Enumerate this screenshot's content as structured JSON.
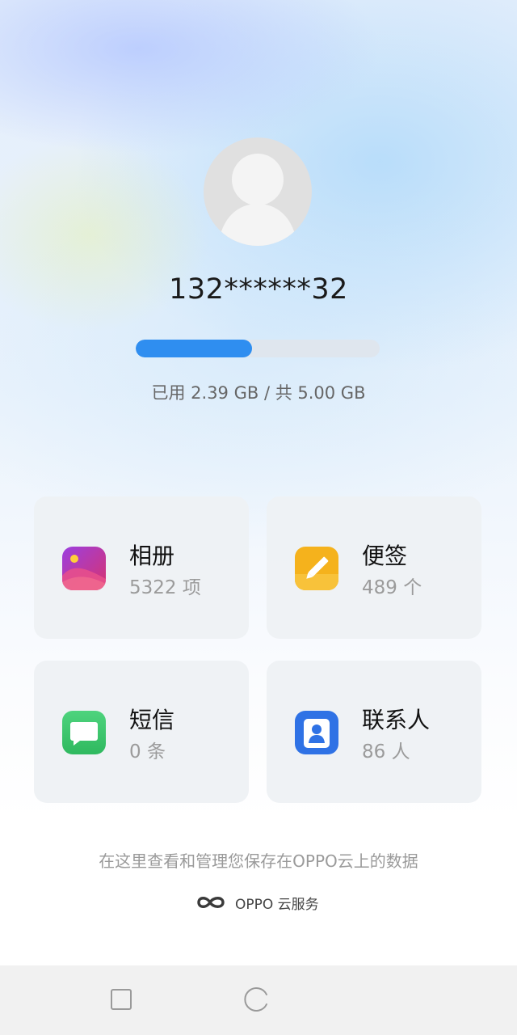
{
  "profile": {
    "account": "132******32"
  },
  "storage": {
    "used_fraction": 0.478,
    "text": "已用 2.39 GB / 共 5.00 GB",
    "bar_color": "#2f8ef0"
  },
  "cards": [
    {
      "title": "相册",
      "count": "5322 项",
      "icon": "gallery-icon"
    },
    {
      "title": "便签",
      "count": "489 个",
      "icon": "notes-icon"
    },
    {
      "title": "短信",
      "count": "0 条",
      "icon": "messages-icon"
    },
    {
      "title": "联系人",
      "count": "86 人",
      "icon": "contacts-icon"
    }
  ],
  "footer": {
    "text": "在这里查看和管理您保存在OPPO云上的数据",
    "brand": "OPPO 云服务"
  },
  "navbar": {
    "buttons": [
      "recent-apps",
      "home"
    ]
  }
}
